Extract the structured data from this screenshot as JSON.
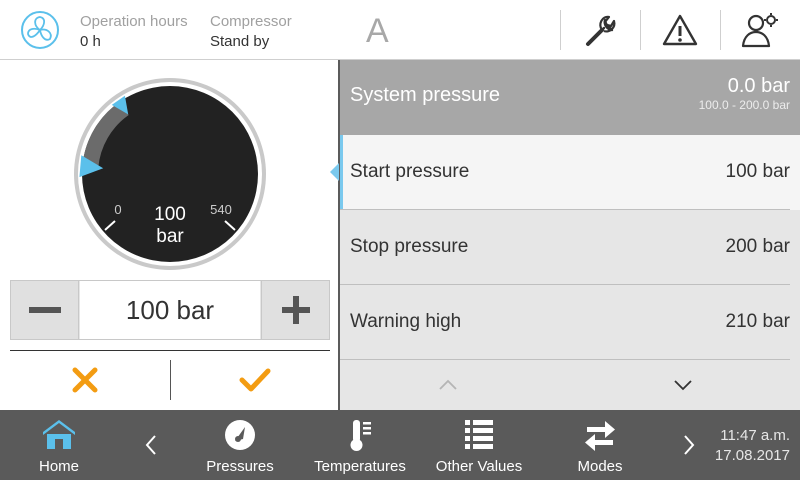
{
  "header": {
    "operation_hours_label": "Operation hours",
    "operation_hours_value": "0 h",
    "compressor_label": "Compressor",
    "compressor_value": "Stand by",
    "mode_letter": "A",
    "icons": [
      "fan-logo-icon",
      "wrench-icon",
      "warning-icon",
      "user-settings-icon"
    ]
  },
  "gauge": {
    "min_label": "0",
    "max_label": "540",
    "value_number": "100",
    "value_unit": "bar",
    "value": 100,
    "range_start": 100,
    "range_end": 200
  },
  "stepper": {
    "value": "100 bar",
    "minus_icon": "minus-icon",
    "plus_icon": "plus-icon"
  },
  "actions": {
    "cancel_icon": "cancel-x-icon",
    "confirm_icon": "confirm-check-icon"
  },
  "system_pressure": {
    "label": "System pressure",
    "value": "0.0 bar",
    "range": "100.0 - 200.0 bar"
  },
  "params": [
    {
      "label": "Start pressure",
      "value": "100 bar"
    },
    {
      "label": "Stop pressure",
      "value": "200 bar"
    },
    {
      "label": "Warning high",
      "value": "210 bar"
    }
  ],
  "nav": {
    "items": [
      {
        "label": "Home",
        "icon": "home-icon"
      },
      {
        "label": "Pressures",
        "icon": "gauge-icon"
      },
      {
        "label": "Temperatures",
        "icon": "thermometer-icon"
      },
      {
        "label": "Other Values",
        "icon": "list-icon"
      },
      {
        "label": "Modes",
        "icon": "swap-arrows-icon"
      }
    ],
    "time": "11:47 a.m.",
    "date": "17.08.2017"
  },
  "colors": {
    "accent_blue": "#5bc0eb",
    "accent_orange": "#f39c12",
    "header_gray": "#a7a7a7",
    "footer_gray": "#5a5a5a"
  }
}
